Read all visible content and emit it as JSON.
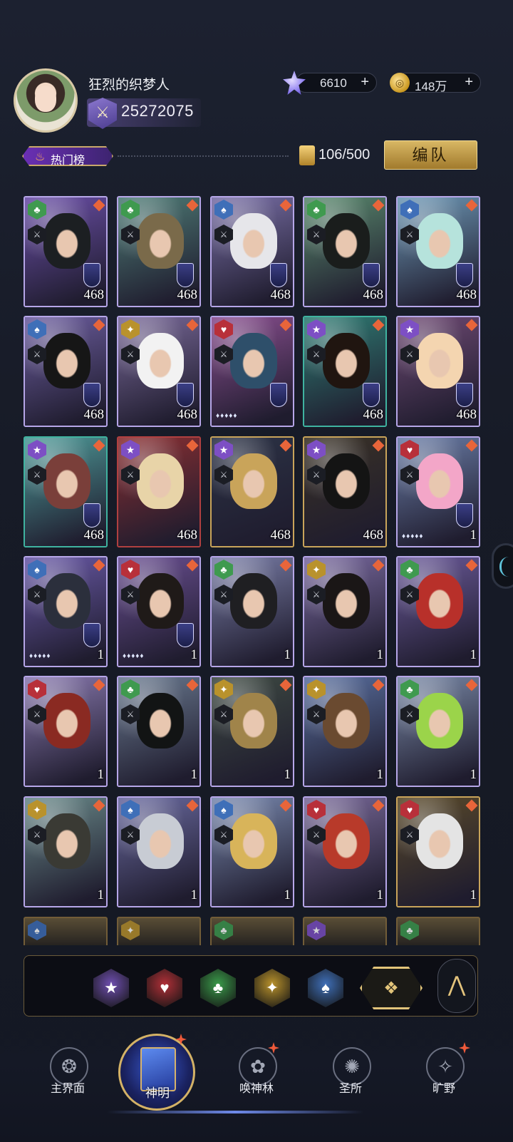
{
  "player": {
    "name": "狂烈的织梦人",
    "power": "25272075"
  },
  "resources": {
    "gems": "6610",
    "coins": "148万",
    "plus": "+"
  },
  "toolbar": {
    "hot_label": "热门榜",
    "card_count": "106/500",
    "team_button": "编队"
  },
  "cards": [
    {
      "suit": "club",
      "suit_color": "#3f9a4f",
      "level": "468",
      "stars": "",
      "frame": "#b6a6e8",
      "bg": "#6b4fa8",
      "hair": "#1c1f22",
      "shield": true
    },
    {
      "suit": "club",
      "suit_color": "#3f9a4f",
      "level": "468",
      "stars": "",
      "frame": "#b6a6e8",
      "bg": "#4f7d77",
      "hair": "#7a6a4a",
      "shield": true
    },
    {
      "suit": "spade",
      "suit_color": "#3f6fb8",
      "level": "468",
      "stars": "",
      "frame": "#b6a6e8",
      "bg": "#7a70a8",
      "hair": "#e6e6ea",
      "shield": true
    },
    {
      "suit": "club",
      "suit_color": "#3f9a4f",
      "level": "468",
      "stars": "",
      "frame": "#b6a6e8",
      "bg": "#5a8a6e",
      "hair": "#1a1d1c",
      "shield": true
    },
    {
      "suit": "spade",
      "suit_color": "#3f6fb8",
      "level": "468",
      "stars": "",
      "frame": "#b6a6e8",
      "bg": "#6f9ab8",
      "hair": "#b6e3dc",
      "shield": true
    },
    {
      "suit": "spade",
      "suit_color": "#3f6fb8",
      "level": "468",
      "stars": "",
      "frame": "#b6a6e8",
      "bg": "#6d5ea0",
      "hair": "#161616",
      "shield": true
    },
    {
      "suit": "diamond",
      "suit_color": "#b9922c",
      "level": "468",
      "stars": "",
      "frame": "#b6a6e8",
      "bg": "#7a6a9a",
      "hair": "#f2f2f2",
      "shield": true
    },
    {
      "suit": "heart",
      "suit_color": "#b8303a",
      "level": "",
      "stars": "♦♦♦♦♦",
      "frame": "#b6a6e8",
      "bg": "#8a4f90",
      "hair": "#2e4f6a",
      "shield": true
    },
    {
      "suit": "star",
      "suit_color": "#7d4fc4",
      "level": "468",
      "stars": "",
      "frame": "#3fb3a0",
      "bg": "#2f7d74",
      "hair": "#201510",
      "shield": true
    },
    {
      "suit": "star",
      "suit_color": "#7d4fc4",
      "level": "468",
      "stars": "",
      "frame": "#b6a6e8",
      "bg": "#6f4a74",
      "hair": "#f4d5b0",
      "shield": true
    },
    {
      "suit": "star",
      "suit_color": "#7d4fc4",
      "level": "468",
      "stars": "",
      "frame": "#3fb3a0",
      "bg": "#4f9c9a",
      "hair": "#7a3f3a",
      "shield": true
    },
    {
      "suit": "star",
      "suit_color": "#7d4fc4",
      "level": "468",
      "stars": "",
      "frame": "#b04040",
      "bg": "#8a2f32",
      "hair": "#e8d4a8",
      "shield": false
    },
    {
      "suit": "star",
      "suit_color": "#7d4fc4",
      "level": "468",
      "stars": "",
      "frame": "#c9a45a",
      "bg": "#2c3346",
      "hair": "#c9a45a",
      "shield": false
    },
    {
      "suit": "star",
      "suit_color": "#7d4fc4",
      "level": "468",
      "stars": "",
      "frame": "#c9a45a",
      "bg": "#3a3226",
      "hair": "#141414",
      "shield": false
    },
    {
      "suit": "heart",
      "suit_color": "#b8303a",
      "level": "1",
      "stars": "♦♦♦♦♦",
      "frame": "#b6a6e8",
      "bg": "#6b7ea8",
      "hair": "#f3a6c8",
      "shield": true
    },
    {
      "suit": "spade",
      "suit_color": "#3f6fb8",
      "level": "1",
      "stars": "♦♦♦♦♦",
      "frame": "#b6a6e8",
      "bg": "#6a5aa8",
      "hair": "#2b2f3c",
      "shield": true
    },
    {
      "suit": "heart",
      "suit_color": "#b8303a",
      "level": "1",
      "stars": "♦♦♦♦♦",
      "frame": "#b6a6e8",
      "bg": "#6a4f92",
      "hair": "#1f1a18",
      "shield": true
    },
    {
      "suit": "club",
      "suit_color": "#3f9a4f",
      "level": "1",
      "stars": "",
      "frame": "#b6a6e8",
      "bg": "#7a7ea8",
      "hair": "#1f1f22",
      "shield": false
    },
    {
      "suit": "diamond",
      "suit_color": "#b9922c",
      "level": "1",
      "stars": "",
      "frame": "#b6a6e8",
      "bg": "#7a6aa0",
      "hair": "#1a1616",
      "shield": false
    },
    {
      "suit": "club",
      "suit_color": "#3f9a4f",
      "level": "1",
      "stars": "",
      "frame": "#b6a6e8",
      "bg": "#6b5a9a",
      "hair": "#b8302a",
      "shield": false
    },
    {
      "suit": "heart",
      "suit_color": "#b8303a",
      "level": "1",
      "stars": "",
      "frame": "#b6a6e8",
      "bg": "#8a7ab0",
      "hair": "#8a2a22",
      "shield": false
    },
    {
      "suit": "club",
      "suit_color": "#3f9a4f",
      "level": "1",
      "stars": "",
      "frame": "#b6a6e8",
      "bg": "#6a7a90",
      "hair": "#121414",
      "shield": false
    },
    {
      "suit": "diamond",
      "suit_color": "#b9922c",
      "level": "1",
      "stars": "",
      "frame": "#b6a6e8",
      "bg": "#3e4a42",
      "hair": "#a0844a",
      "shield": false
    },
    {
      "suit": "diamond",
      "suit_color": "#b9922c",
      "level": "1",
      "stars": "",
      "frame": "#b6a6e8",
      "bg": "#5a70a0",
      "hair": "#6a4a30",
      "shield": false
    },
    {
      "suit": "club",
      "suit_color": "#3f9a4f",
      "level": "1",
      "stars": "",
      "frame": "#b6a6e8",
      "bg": "#7a8aa8",
      "hair": "#9bd44a",
      "shield": false
    },
    {
      "suit": "diamond",
      "suit_color": "#b9922c",
      "level": "1",
      "stars": "",
      "frame": "#b6a6e8",
      "bg": "#6a8a8a",
      "hair": "#3a3a34",
      "shield": false
    },
    {
      "suit": "spade",
      "suit_color": "#3f6fb8",
      "level": "1",
      "stars": "",
      "frame": "#b6a6e8",
      "bg": "#6a6aa0",
      "hair": "#c8ccd4",
      "shield": false
    },
    {
      "suit": "spade",
      "suit_color": "#3f6fb8",
      "level": "1",
      "stars": "",
      "frame": "#b6a6e8",
      "bg": "#7a8ab0",
      "hair": "#d8b45a",
      "shield": false
    },
    {
      "suit": "heart",
      "suit_color": "#b8303a",
      "level": "1",
      "stars": "",
      "frame": "#b6a6e8",
      "bg": "#7a6a9a",
      "hair": "#b83a2a",
      "shield": false
    },
    {
      "suit": "heart",
      "suit_color": "#b8303a",
      "level": "1",
      "stars": "",
      "frame": "#c9a45a",
      "bg": "#5a4a2a",
      "hair": "#e4e4e4",
      "shield": false
    }
  ],
  "peek_cards": [
    {
      "suit": "spade",
      "suit_color": "#3f6fb8"
    },
    {
      "suit": "diamond",
      "suit_color": "#b9922c"
    },
    {
      "suit": "club",
      "suit_color": "#3f9a4f"
    },
    {
      "suit": "star",
      "suit_color": "#7d4fc4"
    },
    {
      "suit": "club",
      "suit_color": "#3f9a4f"
    }
  ],
  "filters": [
    {
      "name": "star",
      "color": "#6f4fb0",
      "glyph": "★"
    },
    {
      "name": "heart",
      "color": "#b03038",
      "glyph": "♥"
    },
    {
      "name": "club",
      "color": "#3a9a4a",
      "glyph": "♣"
    },
    {
      "name": "diamond",
      "color": "#b9922c",
      "glyph": "✦"
    },
    {
      "name": "spade",
      "color": "#3f6fb8",
      "glyph": "♠"
    }
  ],
  "nav": {
    "items": [
      {
        "label": "主界面"
      },
      {
        "label": "神明"
      },
      {
        "label": "唤神林"
      },
      {
        "label": "圣所"
      },
      {
        "label": "旷野"
      }
    ]
  }
}
